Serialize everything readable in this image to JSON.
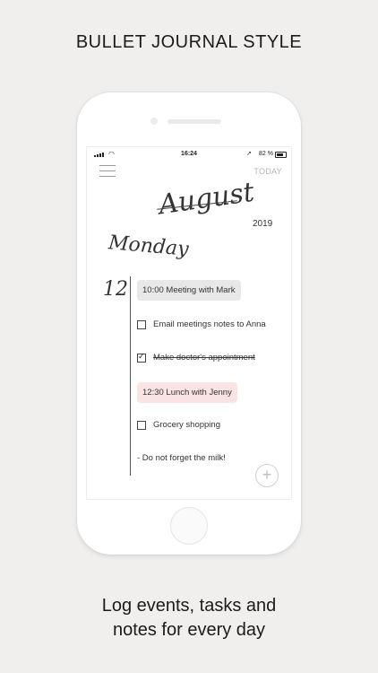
{
  "headline": "BULLET JOURNAL STYLE",
  "caption": {
    "line1": "Log events, tasks and",
    "line2": "notes for every day"
  },
  "status_bar": {
    "time": "16:24",
    "battery": "82 %",
    "location_icon": "location-arrow-icon",
    "wifi_icon": "wifi-icon"
  },
  "header": {
    "menu_icon": "hamburger-menu-icon",
    "today_label": "TODAY",
    "month": "August",
    "year": "2019"
  },
  "day": {
    "weekday": "Monday",
    "date": "12"
  },
  "entries": [
    {
      "kind": "event",
      "text": "10:00 Meeting with Mark",
      "color": "#e8e8e8"
    },
    {
      "kind": "task",
      "text": "Email meetings notes to Anna",
      "checked": false
    },
    {
      "kind": "task",
      "text": "Make doctor's appointment",
      "checked": true
    },
    {
      "kind": "event",
      "text": "12:30 Lunch with Jenny",
      "color": "#f9e4e3"
    },
    {
      "kind": "task",
      "text": "Grocery shopping",
      "checked": false
    },
    {
      "kind": "note",
      "text": "- Do not forget the milk!"
    }
  ],
  "add_button": {
    "icon": "plus-icon",
    "label": "+"
  },
  "colors": {
    "background": "#f0efee",
    "event_grey": "#e8e8e8",
    "event_pink": "#f9e4e3",
    "today_text": "#b5b5b5"
  }
}
